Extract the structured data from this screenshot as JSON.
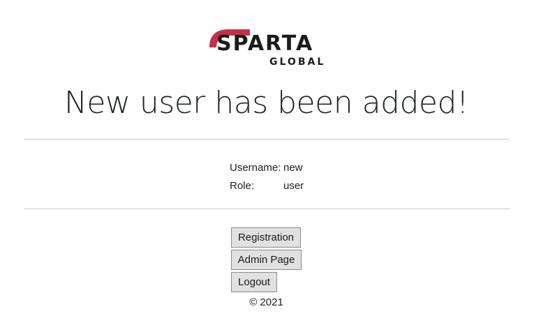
{
  "logo": {
    "word": "SPARTA",
    "sub": "GLOBAL",
    "accent_color": "#c8304a"
  },
  "headline": "New user has been added!",
  "details": {
    "username_label": "Username:",
    "username_value": "new",
    "role_label": "Role:",
    "role_value": "user"
  },
  "buttons": {
    "registration": "Registration",
    "admin_page": "Admin Page",
    "logout": "Logout"
  },
  "footer": {
    "copyright": "© 2021"
  }
}
